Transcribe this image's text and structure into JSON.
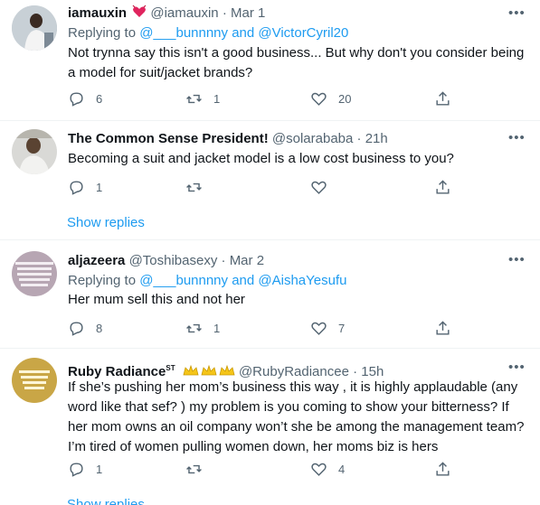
{
  "tweets": [
    {
      "name": "iamauxin",
      "handle": "@iamauxin",
      "time": "Mar 1",
      "reply_prefix": "Replying to ",
      "reply_mentions": "@___bunnnny and @VictorCyril20",
      "text_lines": [
        "Not trynna say this isn't a good business... But why don't you consider being",
        "a model for suit/jacket brands?"
      ],
      "reply_count": "6",
      "retweet_count": "1",
      "like_count": "20",
      "badge": "heart-emoji"
    },
    {
      "name": "The Common Sense President!",
      "handle": "@solarababa",
      "time": "21h",
      "text_lines": [
        "Becoming a suit and jacket model is a low cost business to you?"
      ],
      "reply_count": "1",
      "retweet_count": "",
      "like_count": "",
      "show_replies": "Show replies"
    },
    {
      "name": "aljazeera",
      "handle": "@Toshibasexy",
      "time": "Mar 2",
      "reply_prefix": "Replying to ",
      "reply_mentions": "@___bunnnny and @AishaYesufu",
      "text_lines": [
        "Her mum sell this and not her"
      ],
      "reply_count": "8",
      "retweet_count": "1",
      "like_count": "7"
    },
    {
      "name": "Ruby Radiance",
      "name_sup": "ST",
      "handle": "@RubyRadiancee",
      "time": "15h",
      "text_lines": [
        "If she’s pushing her mom’s business this way , it is highly applaudable (any",
        "word like that sef? ) my problem is you coming to show your bitterness? If",
        "her mom owns an oil company won’t she be among the management team?",
        "I’m tired of women pulling women down, her moms biz is hers"
      ],
      "reply_count": "1",
      "retweet_count": "",
      "like_count": "4",
      "show_replies": "Show replies",
      "badge": "crown-emojis"
    }
  ],
  "colors": {
    "accent": "#1d9bf0",
    "muted": "#536471",
    "text": "#0f1419",
    "divider": "#eff3f4"
  }
}
